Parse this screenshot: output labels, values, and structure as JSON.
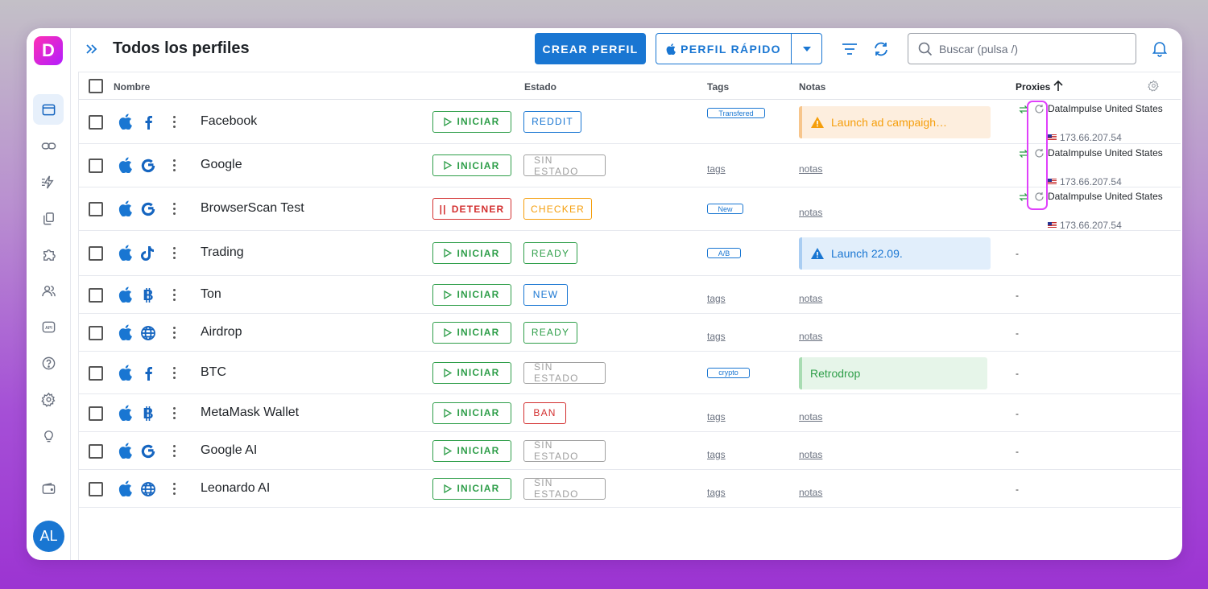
{
  "header": {
    "title": "Todos los perfiles",
    "create_label": "CREAR PERFIL",
    "quick_label": "PERFIL RÁPIDO",
    "search_placeholder": "Buscar (pulsa /)"
  },
  "sidebar": {
    "logo_letter": "D",
    "avatar": "AL",
    "items": [
      "browser-icon",
      "link-icon",
      "lightning-icon",
      "copy-icon",
      "puzzle-icon",
      "users-icon",
      "api-icon",
      "help-icon",
      "settings-icon",
      "bulb-icon",
      "wallet-icon"
    ]
  },
  "columns": {
    "name": "Nombre",
    "status": "Estado",
    "tags": "Tags",
    "notes": "Notas",
    "proxies": "Proxies"
  },
  "actions": {
    "start": "INICIAR",
    "stop": "DETENER"
  },
  "placeholders": {
    "tags": "tags",
    "notes": "notas",
    "empty": "-"
  },
  "colors": {
    "primary": "#1976d2",
    "green": "#2e9e49",
    "red": "#d32f2f",
    "orange": "#f59e0b",
    "grey": "#9e9e9e",
    "highlight": "#e040fb"
  },
  "rows": [
    {
      "name": "Facebook",
      "icon": "facebook-icon",
      "action": "start",
      "status": "REDDIT",
      "status_color": "blue",
      "tag": "Transfered",
      "note": {
        "text": "Launch ad campaigh…",
        "kind": "warning-orange"
      },
      "proxy": {
        "name": "DataImpulse United States",
        "ip": "173.66.207.54"
      }
    },
    {
      "name": "Google",
      "icon": "google-icon",
      "action": "start",
      "status": "SIN ESTADO",
      "status_color": "grey",
      "tag": "",
      "note": null,
      "proxy": {
        "name": "DataImpulse United States",
        "ip": "173.66.207.54"
      }
    },
    {
      "name": "BrowserScan Test",
      "icon": "google-icon",
      "action": "stop",
      "status": "CHECKER",
      "status_color": "orange",
      "tag": "New",
      "note": null,
      "proxy": {
        "name": "DataImpulse United States",
        "ip": "173.66.207.54"
      }
    },
    {
      "name": "Trading",
      "icon": "tiktok-icon",
      "action": "start",
      "status": "READY",
      "status_color": "green",
      "tag": "A/B",
      "note": {
        "text": "Launch 22.09.",
        "kind": "warning-blue"
      },
      "proxy": null
    },
    {
      "name": "Ton",
      "icon": "bitcoin-icon",
      "action": "start",
      "status": "NEW",
      "status_color": "blue",
      "tag": "",
      "note": null,
      "proxy": null
    },
    {
      "name": "Airdrop",
      "icon": "globe-icon",
      "action": "start",
      "status": "READY",
      "status_color": "green",
      "tag": "",
      "note": null,
      "proxy": null
    },
    {
      "name": "BTC",
      "icon": "facebook-icon",
      "action": "start",
      "status": "SIN ESTADO",
      "status_color": "grey",
      "tag": "crypto",
      "note": {
        "text": "Retrodrop",
        "kind": "green"
      },
      "proxy": null
    },
    {
      "name": "MetaMask Wallet",
      "icon": "bitcoin-icon",
      "action": "start",
      "status": "BAN",
      "status_color": "red",
      "tag": "",
      "note": null,
      "proxy": null
    },
    {
      "name": "Google AI",
      "icon": "google-icon",
      "action": "start",
      "status": "SIN ESTADO",
      "status_color": "grey",
      "tag": "",
      "note": null,
      "proxy": null
    },
    {
      "name": "Leonardo AI",
      "icon": "globe-icon",
      "action": "start",
      "status": "SIN ESTADO",
      "status_color": "grey",
      "tag": "",
      "note": null,
      "proxy": null
    }
  ]
}
